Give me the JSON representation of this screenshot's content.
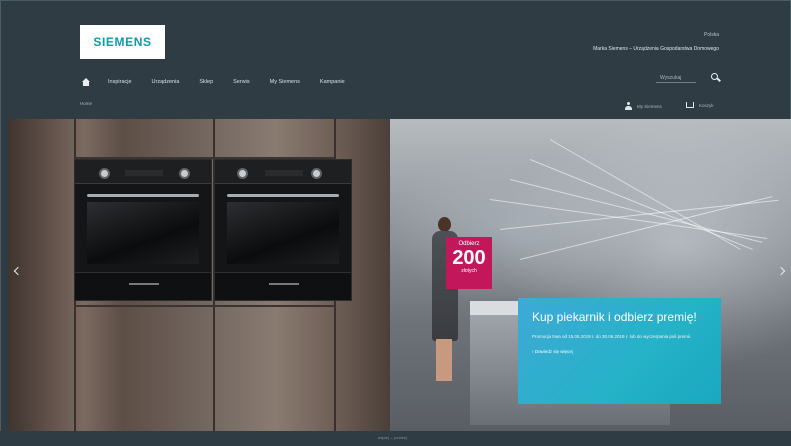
{
  "header": {
    "logo_text": "SIEMENS",
    "country": "Polska",
    "tagline": "Marka Siemens – Urządzenia Gospodarstwa Domowego"
  },
  "nav": {
    "home_icon": "home-icon",
    "items": [
      "Inspiracje",
      "Urządzenia",
      "Sklep",
      "Serwis",
      "My Siemens",
      "Kampanie"
    ]
  },
  "search": {
    "placeholder": "Wyszukaj",
    "icon": "search-icon"
  },
  "breadcrumb": "Home",
  "account": {
    "label": "My Siemens",
    "icon": "person-icon"
  },
  "cart": {
    "label": "Koszyk",
    "icon": "cart-icon"
  },
  "hero": {
    "badge": {
      "line1": "Odbierz",
      "amount": "200",
      "line3": "złotych"
    },
    "promo": {
      "title": "Kup piekarnik i odbierz premię!",
      "body": "Promocja trwa od 15.05.2019 r. do 30.06.2019 r. lub do wyczerpania puli premii.",
      "link": "›  Dowiedz się więcej"
    }
  },
  "footer": {
    "scroll_text": "więcej ⌄ poniżej"
  },
  "colors": {
    "background": "#2f3c44",
    "promo": "#25b2c7",
    "badge": "#c2185b"
  }
}
